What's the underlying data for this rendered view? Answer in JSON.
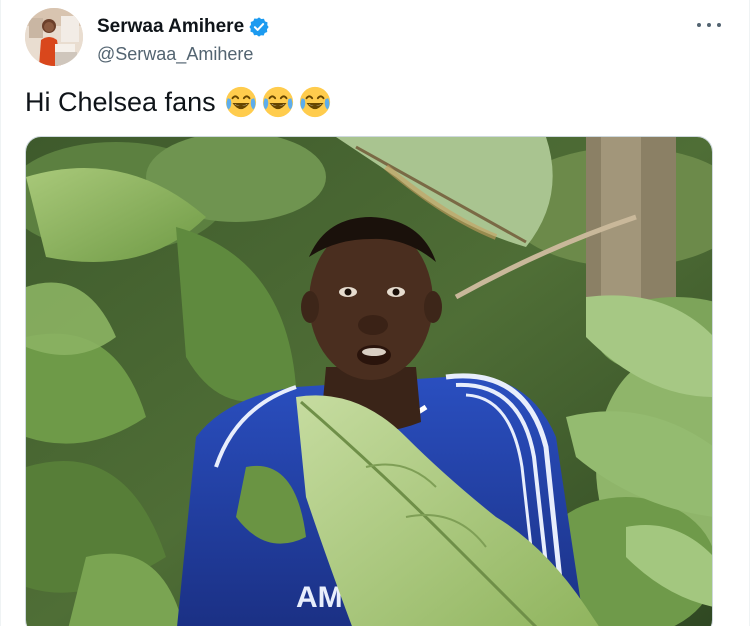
{
  "tweet": {
    "author": {
      "display_name": "Serwaa Amihere",
      "handle": "@Serwaa_Amihere",
      "verified": true,
      "avatar_icon": "profile-photo"
    },
    "text": "Hi Chelsea fans",
    "emojis": [
      "face-with-tears-of-joy",
      "face-with-tears-of-joy",
      "face-with-tears-of-joy"
    ],
    "more_icon": "more-options-icon",
    "media": {
      "kind": "photo",
      "jersey_text": "AMSU"
    },
    "colors": {
      "verified_blue": "#1d9bf0",
      "text_primary": "#0f1419",
      "text_secondary": "#536471",
      "jersey_blue": "#1f3fa6"
    }
  }
}
